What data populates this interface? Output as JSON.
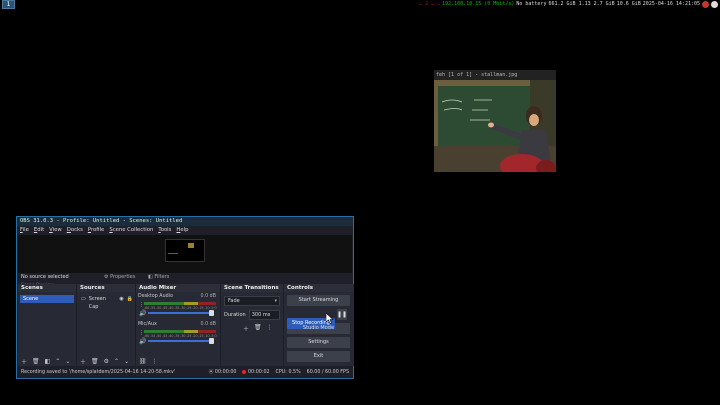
{
  "topbar": {
    "workspace": "1",
    "status_red": "… 2 … …",
    "status_green": "192.168.10.15 (0 Mbit/s)",
    "battery": "No battery",
    "mem": "661.2 GiB  1.13  2.7 GiB",
    "disk": "10.6 GiB",
    "datetime": "2025-04-16 14:21:05"
  },
  "feh": {
    "title": "feh [1 of 1] - stallman.jpg"
  },
  "obs": {
    "title": "OBS 31.0.3 - Profile: Untitled - Scenes: Untitled",
    "menu": [
      "File",
      "Edit",
      "View",
      "Docks",
      "Profile",
      "Scene Collection",
      "Tools",
      "Help"
    ],
    "scene_label": "Scene Preview",
    "no_source": "No source selected",
    "properties_label": "Properties",
    "filters_label": "Filters",
    "docks": {
      "scenes": {
        "title": "Scenes",
        "items": [
          "Scene"
        ]
      },
      "sources": {
        "title": "Sources",
        "items": [
          "Screen Cap"
        ]
      },
      "mixer": {
        "title": "Audio Mixer",
        "channels": [
          {
            "name": "Desktop Audio",
            "db": "0.0 dB"
          },
          {
            "name": "Mic/Aux",
            "db": "0.0 dB"
          }
        ],
        "ticks": "-60 -55 -50 -45 -40 -35 -30 -25 -20 -15 -10 -5 0"
      },
      "transitions": {
        "title": "Scene Transitions",
        "type": "Fade",
        "duration_label": "Duration",
        "duration": "300 ms"
      },
      "controls": {
        "title": "Controls",
        "start_streaming": "Start Streaming",
        "stop_recording": "Stop Recording",
        "studio_mode": "Studio Mode",
        "settings": "Settings",
        "exit": "Exit"
      }
    },
    "statusbar": {
      "message": "Recording saved to '/home/splatdem/2025-04-16 14-20-58.mkv'",
      "stream_time": "00:00:00",
      "rec_time": "00:00:02",
      "cpu": "CPU: 0.5%",
      "fps": "60.00 / 60.00 FPS"
    }
  },
  "colors": {
    "accent": "#2f5cb8",
    "record": "#ee2222",
    "window_border": "#2a6ea8"
  }
}
